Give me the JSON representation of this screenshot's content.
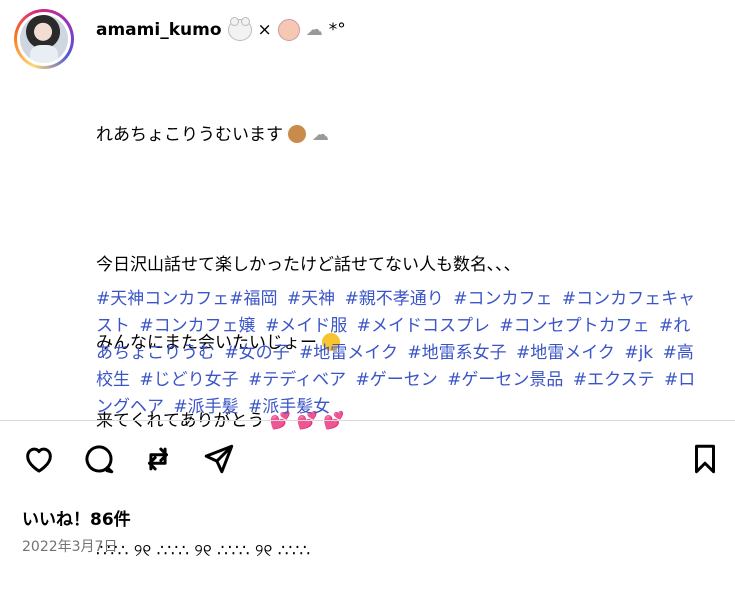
{
  "post": {
    "username": "amami_kumo",
    "username_suffix": "×",
    "username_suffix2": "*°",
    "caption_lines": [
      "れあちょこりうむいます",
      "",
      "今日沢山話せて楽しかったけど話せてない人も数名､､､",
      "みんなにまた会いたいじょー",
      "来てくれてありがとう",
      "",
      "∴∵∴ ୨୧ ∴∵∴ ୨୧ ∴∵∴ ୨୧ ∴∵∴"
    ],
    "hashtags": [
      "#天神コンカフェ#福岡",
      "#天神",
      "#親不孝通り",
      "#コンカフェ",
      "#コンカフェキャスト",
      "#コンカフェ嬢",
      "#メイド服",
      "#メイドコスプレ",
      "#コンセプトカフェ",
      "#れあちょこりうむ",
      "#女の子",
      "#地雷メイク",
      "#地雷系女子",
      "#地雷メイク",
      "#jk",
      "#高校生",
      "#じどり女子",
      "#テディベア",
      "#ゲーセン",
      "#ゲーセン景品",
      "#エクステ",
      "#ロングヘア",
      "#派手髪",
      "#派手髪女"
    ],
    "likes": "いいね！86件",
    "date": "2022年3月7日"
  },
  "icons": {
    "like": "heart-icon",
    "comment": "comment-icon",
    "repost": "repost-icon",
    "share": "share-icon",
    "save": "bookmark-icon"
  },
  "colors": {
    "hashtag": "#3b55c7",
    "divider": "#dbdbdb",
    "date": "#737373"
  }
}
